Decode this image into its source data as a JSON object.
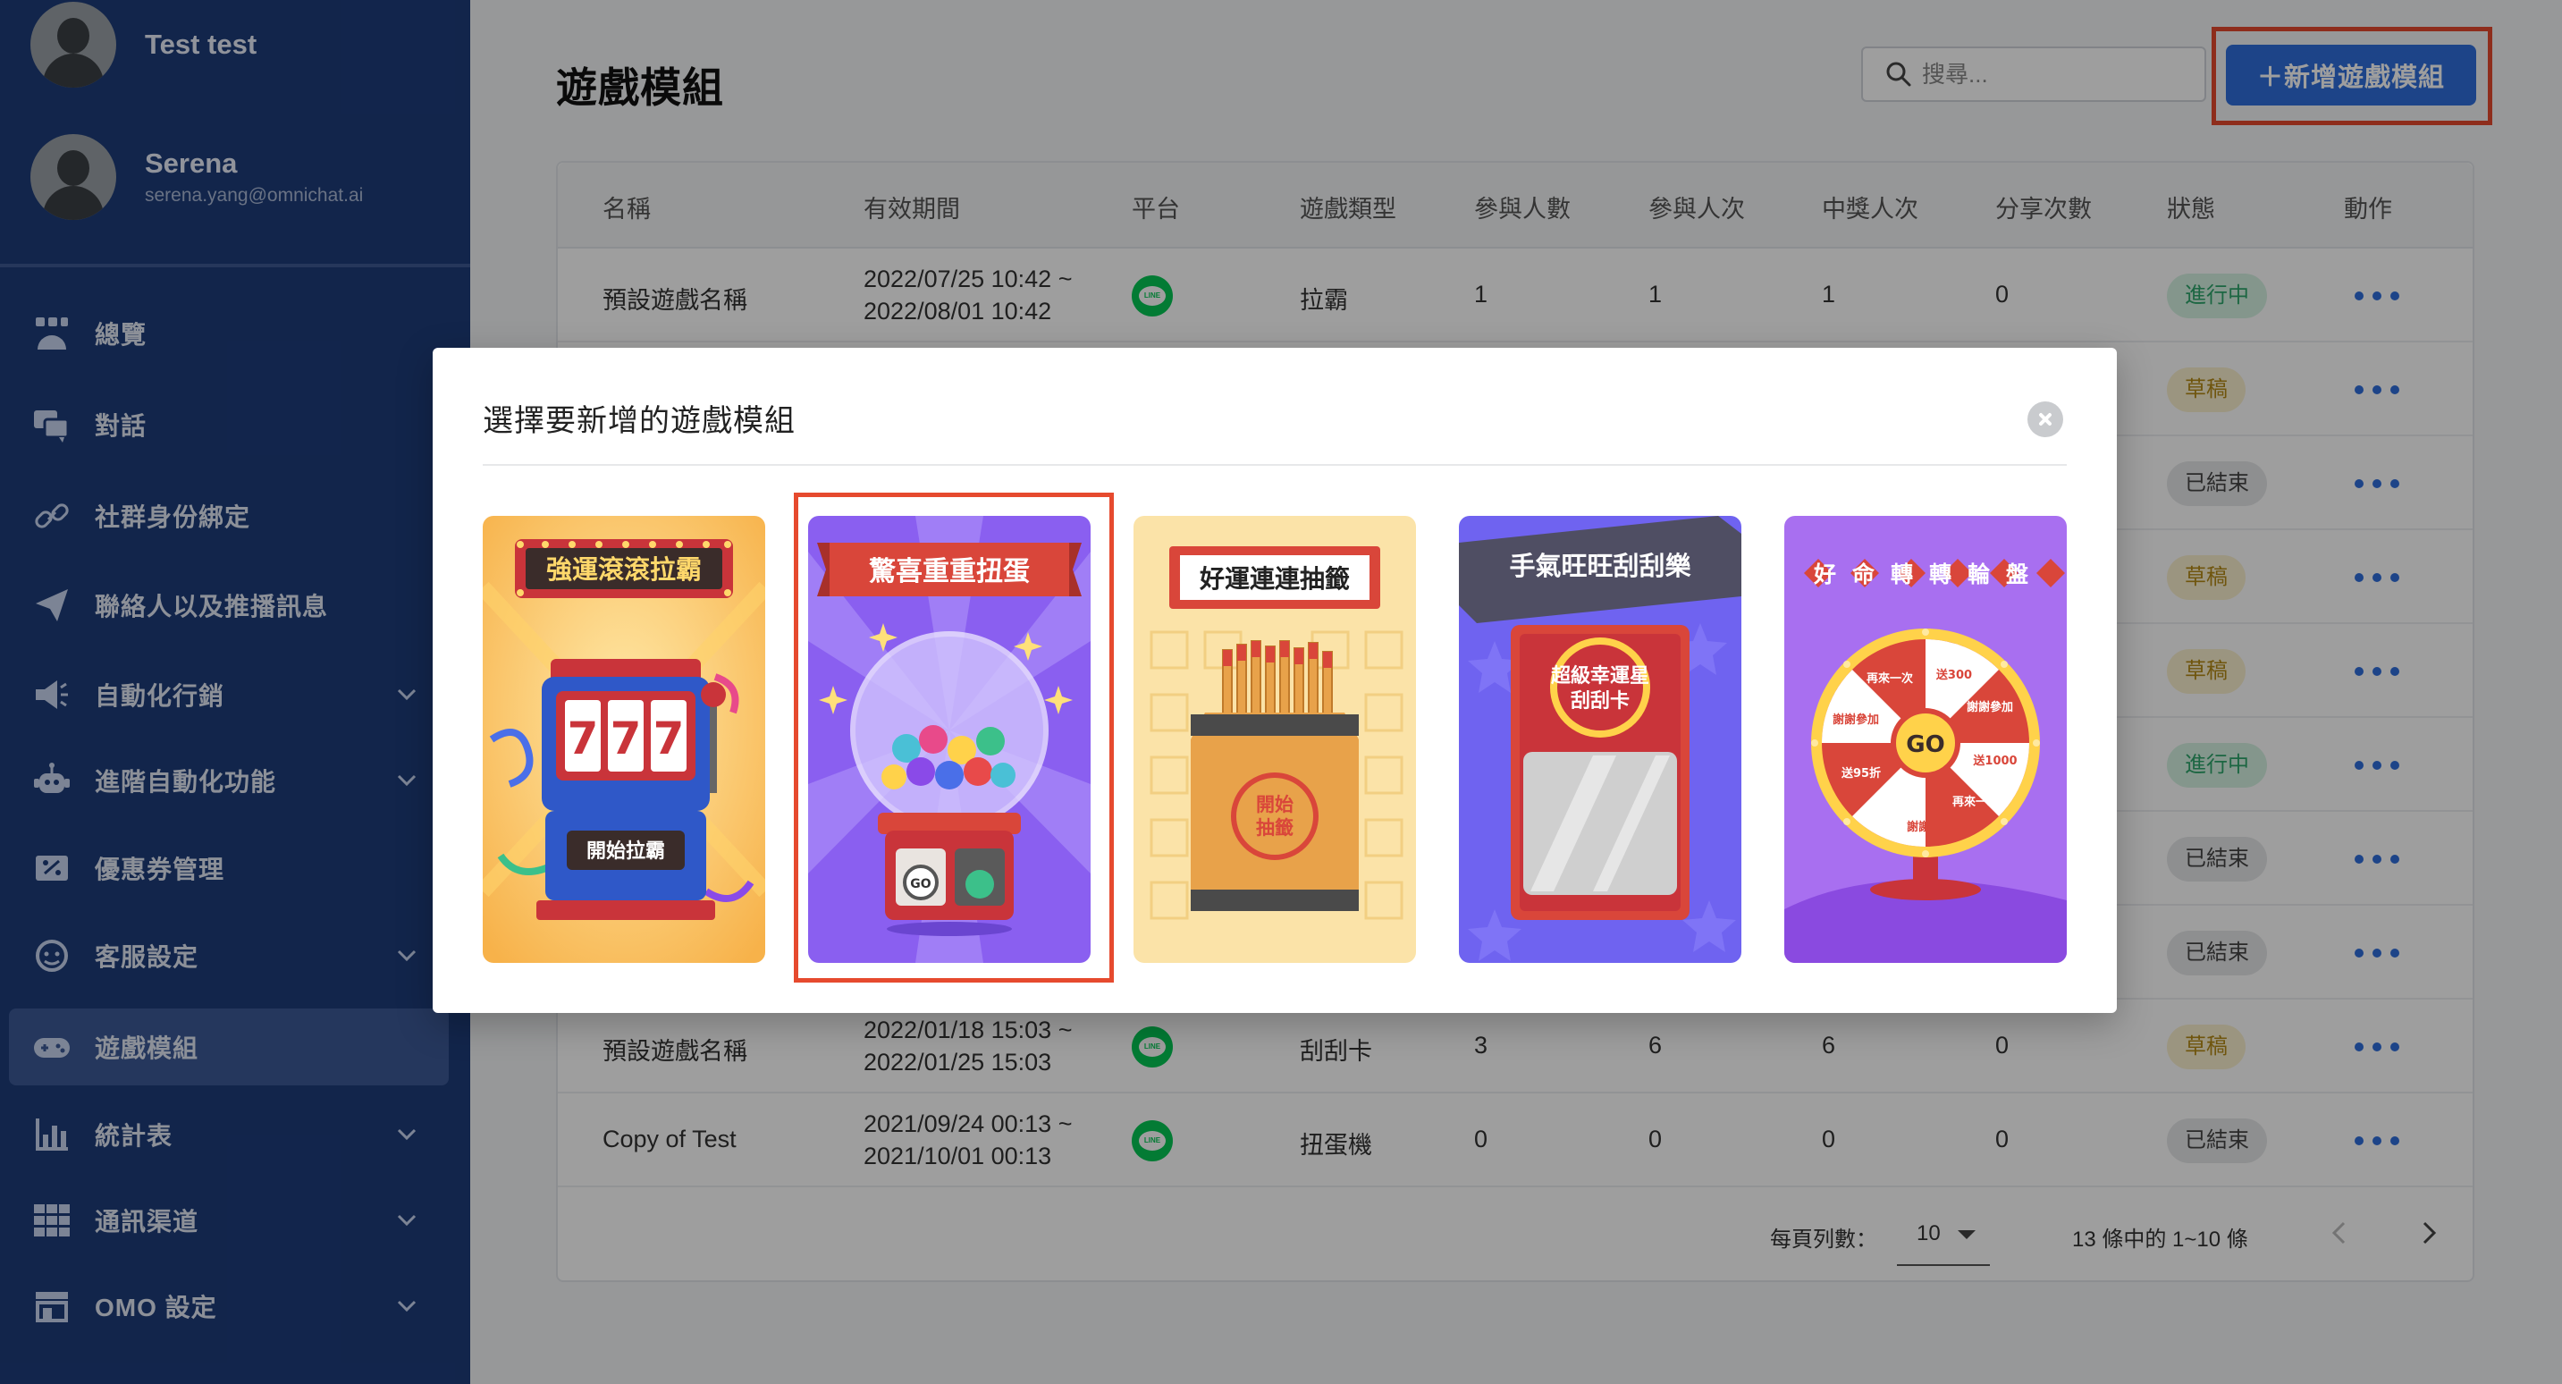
{
  "sidebar": {
    "accounts": [
      {
        "name": "Test test",
        "email": ""
      },
      {
        "name": "Serena",
        "email": "serena.yang@omnichat.ai"
      }
    ],
    "items": [
      {
        "label": "總覽",
        "icon": "dashboard-icon"
      },
      {
        "label": "對話",
        "icon": "chat-icon"
      },
      {
        "label": "社群身份綁定",
        "icon": "link-icon"
      },
      {
        "label": "聯絡人以及推播訊息",
        "icon": "send-icon"
      },
      {
        "label": "自動化行銷",
        "icon": "megaphone-icon",
        "expandable": true
      },
      {
        "label": "進階自動化功能",
        "icon": "robot-icon",
        "expandable": true
      },
      {
        "label": "優惠券管理",
        "icon": "coupon-icon"
      },
      {
        "label": "客服設定",
        "icon": "support-icon",
        "expandable": true
      },
      {
        "label": "遊戲模組",
        "icon": "gamepad-icon",
        "active": true
      },
      {
        "label": "統計表",
        "icon": "bar-chart-icon",
        "expandable": true
      },
      {
        "label": "通訊渠道",
        "icon": "grid-icon",
        "expandable": true
      },
      {
        "label": "OMO 設定",
        "icon": "store-icon",
        "expandable": true
      }
    ]
  },
  "header": {
    "title": "遊戲模組",
    "search_placeholder": "搜尋...",
    "add_button": "＋新增遊戲模組"
  },
  "table": {
    "columns": [
      "名稱",
      "有效期間",
      "平台",
      "遊戲類型",
      "參與人數",
      "參與人次",
      "中獎人次",
      "分享次數",
      "狀態",
      "動作"
    ],
    "rows": [
      {
        "name": "預設遊戲名稱",
        "period_start": "2022/07/25 10:42 ~",
        "period_end": "2022/08/01 10:42",
        "platform": "LINE",
        "type": "拉霸",
        "participants": "1",
        "participations": "1",
        "winners": "1",
        "shares": "0",
        "status": "進行中",
        "status_kind": "ongoing"
      },
      {
        "status": "草稿",
        "status_kind": "draft"
      },
      {
        "status": "已結束",
        "status_kind": "ended"
      },
      {
        "status": "草稿",
        "status_kind": "draft"
      },
      {
        "status": "草稿",
        "status_kind": "draft"
      },
      {
        "status": "進行中",
        "status_kind": "ongoing"
      },
      {
        "status": "已結束",
        "status_kind": "ended"
      },
      {
        "status": "已結束",
        "status_kind": "ended"
      },
      {
        "name": "預設遊戲名稱",
        "period_start": "2022/01/18 15:03 ~",
        "period_end": "2022/01/25 15:03",
        "platform": "LINE",
        "type": "刮刮卡",
        "participants": "3",
        "participations": "6",
        "winners": "6",
        "shares": "0",
        "status": "草稿",
        "status_kind": "draft"
      },
      {
        "name": "Copy of Test",
        "period_start": "2021/09/24 00:13 ~",
        "period_end": "2021/10/01 00:13",
        "platform": "LINE",
        "type": "扭蛋機",
        "participants": "0",
        "participations": "0",
        "winners": "0",
        "shares": "0",
        "status": "已結束",
        "status_kind": "ended"
      }
    ]
  },
  "pagination": {
    "per_page_label": "每頁列數：",
    "per_page": "10",
    "range": "13 條中的 1~10 條"
  },
  "modal": {
    "title": "選擇要新增的遊戲模組",
    "cards": [
      {
        "title": "強運滾滾拉霸",
        "button": "開始拉霸",
        "reels": "777"
      },
      {
        "title": "驚喜重重扭蛋",
        "button": "GO"
      },
      {
        "title": "好運連連抽籤",
        "button_line1": "開始",
        "button_line2": "抽籤"
      },
      {
        "title": "手氣旺旺刮刮樂",
        "subtitle_line1": "超級幸運星",
        "subtitle_line2": "刮刮卡"
      },
      {
        "title": "好命轉轉輪盤",
        "center": "GO",
        "segments": [
          "送300",
          "謝謝參加",
          "送1000",
          "再來一次",
          "謝謝",
          "送95折",
          "謝謝參加",
          "再來一次"
        ]
      }
    ]
  },
  "colors": {
    "sidebar_bg": "#1d3c7a",
    "primary": "#2f6fdc",
    "highlight": "#e64a2e",
    "line_green": "#06c755"
  }
}
